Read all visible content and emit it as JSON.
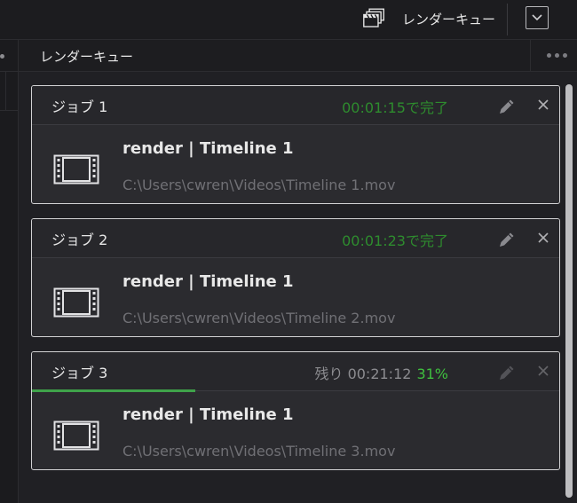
{
  "toolbar": {
    "render_queue_label": "レンダーキュー",
    "render_queue_icon": "clapperboard-stack-icon",
    "dropdown_icon": "chevron-down-icon"
  },
  "panel": {
    "title": "レンダーキュー",
    "more_icon": "more-dots-icon"
  },
  "jobs": [
    {
      "name": "ジョブ 1",
      "status": "00:01:15で完了",
      "remaining": "",
      "percent": "",
      "progress": 1.0,
      "title": "render | Timeline 1",
      "path": "C:\\Users\\cwren\\Videos\\Timeline 1.mov",
      "completed": true
    },
    {
      "name": "ジョブ 2",
      "status": "00:01:23で完了",
      "remaining": "",
      "percent": "",
      "progress": 1.0,
      "title": "render | Timeline 1",
      "path": "C:\\Users\\cwren\\Videos\\Timeline 2.mov",
      "completed": true
    },
    {
      "name": "ジョブ 3",
      "status": "",
      "remaining": "残り 00:21:12",
      "percent": "31%",
      "progress": 0.31,
      "title": "render | Timeline 1",
      "path": "C:\\Users\\cwren\\Videos\\Timeline 3.mov",
      "completed": false
    }
  ],
  "colors": {
    "completed_status": "#2e8c2e",
    "progress_bar": "#3fa34a",
    "percent_text": "#3fbf3f"
  }
}
